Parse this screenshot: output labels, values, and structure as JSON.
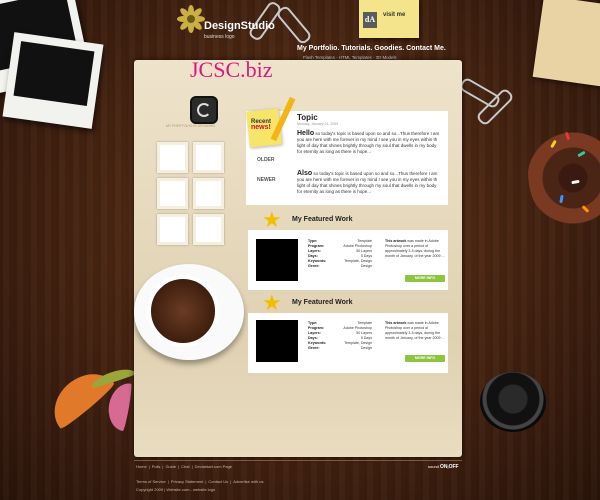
{
  "header": {
    "logo_title": "DesignStudio",
    "logo_subtitle": "business logo",
    "nav_text": "My Portfolio. Tutorials. Goodies. Contact Me.",
    "subnav_text": "Flash Templates - HTML Templates - 3D Models",
    "note_text": "visit me"
  },
  "watermark": "JCSC.biz",
  "sidebar": {
    "tagline": "MY PORTFOLIO IS GROWING",
    "older_label": "OLDER",
    "newer_label": "NEWER"
  },
  "topic": {
    "badge_line1": "Recent",
    "badge_line2": "news!",
    "title": "Topic",
    "date": "Monday, January 01, 2009",
    "para1_lead": "Hello",
    "para1_body": " so today's topic is based upon so and so...Thus therefore I am you are here with me forever in my mind I see you in my eyes within th light of day that shines brightly through my soul that dwells in my body for eternity as long as there is hope...",
    "para2_lead": "Also",
    "para2_body": " so today's topic is based upon so and so...Thus therefore I am you are here with me forever in my mind I see you in my eyes within th light of day that shines brightly through my soul that dwells in my body for eternity as long as there is hope..."
  },
  "featured": [
    {
      "heading": "My Featured Work",
      "meta": [
        {
          "key": "Type:",
          "val": "Template"
        },
        {
          "key": "Program:",
          "val": "Adobe Photoshop"
        },
        {
          "key": "Layers:",
          "val": "50 Layers"
        },
        {
          "key": "Days:",
          "val": "5 Days"
        },
        {
          "key": "Keywords:",
          "val": "Template, Design"
        },
        {
          "key": "Genre:",
          "val": "Design"
        }
      ],
      "desc_lead": "This artwork",
      "desc_body": " was made in Adobe Photoshop over a period of approximately 3-5 days, during the month of January, of the year 2009 ...",
      "button": "MORE INFO"
    },
    {
      "heading": "My Featured Work",
      "meta": [
        {
          "key": "Type:",
          "val": "Template"
        },
        {
          "key": "Program:",
          "val": "Adobe Photoshop"
        },
        {
          "key": "Layers:",
          "val": "50 Layers"
        },
        {
          "key": "Days:",
          "val": "5 Days"
        },
        {
          "key": "Keywords:",
          "val": "Template, Design"
        },
        {
          "key": "Genre:",
          "val": "Design"
        }
      ],
      "desc_lead": "This artwork",
      "desc_body": " was made in Adobe Photoshop over a period of approximately 3-5 days, during the month of January, of the year 2009 ...",
      "button": "MORE INFO"
    }
  ],
  "footer": {
    "links": [
      "Home",
      "|",
      "Polls",
      "|",
      "Guide",
      "|",
      "Chat",
      "|",
      "Deviantart.com Page"
    ],
    "links2": [
      "Terms of Service",
      "|",
      "Privacy Statement",
      "|",
      "Contact Us",
      "|",
      "Advertise with us"
    ],
    "copyright": "Copyright 2009 | Website.com - website logo",
    "sound_label": "sound",
    "sound_on": "ON",
    "sound_sep": "|",
    "sound_off": "OFF"
  },
  "colors": {
    "accent_green": "#8cc63f",
    "watermark_pink": "#e0167a",
    "sheet": "#e8dcc2"
  }
}
